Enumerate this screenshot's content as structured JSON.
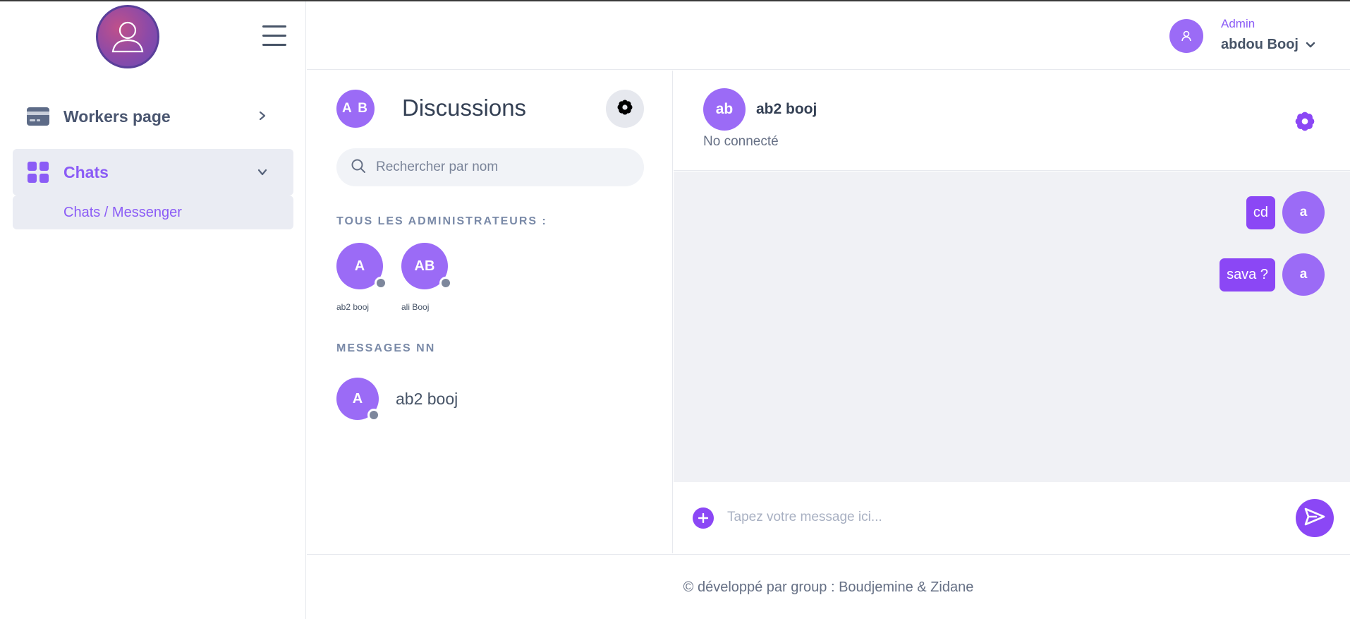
{
  "sidebar": {
    "items": [
      {
        "label": "Workers page",
        "icon": "credit-card-icon",
        "chevron": "chevron-right-icon"
      },
      {
        "label": "Chats",
        "icon": "grid-icon",
        "chevron": "chevron-down-icon",
        "active": true
      }
    ],
    "sub_items": [
      {
        "label": "Chats / Messenger"
      }
    ]
  },
  "header": {
    "user_role": "Admin",
    "user_name": "abdou Booj"
  },
  "discussions": {
    "avatar_initials": "A B",
    "title": "Discussions",
    "search_placeholder": "Rechercher par nom",
    "admins_label": "TOUS LES ADMINISTRATEURS :",
    "admins": [
      {
        "initials": "A",
        "name": "ab2 booj"
      },
      {
        "initials": "AB",
        "name": "ali Booj"
      }
    ],
    "messages_label": "MESSAGES NN",
    "conversations": [
      {
        "initials": "A",
        "name": "ab2 booj"
      }
    ]
  },
  "chat": {
    "contact_initials": "ab",
    "contact_name": "ab2 booj",
    "contact_status": "No connecté",
    "messages": [
      {
        "text": "cd",
        "sender_initial": "a"
      },
      {
        "text": "sava ?",
        "sender_initial": "a"
      }
    ],
    "input_placeholder": "Tapez votre message ici..."
  },
  "footer": {
    "text": "© développé par group : Boudjemine & Zidane"
  },
  "colors": {
    "accent": "#8b5cf6",
    "accent_dark": "#8b47f5",
    "status_offline": "#7d879c"
  }
}
